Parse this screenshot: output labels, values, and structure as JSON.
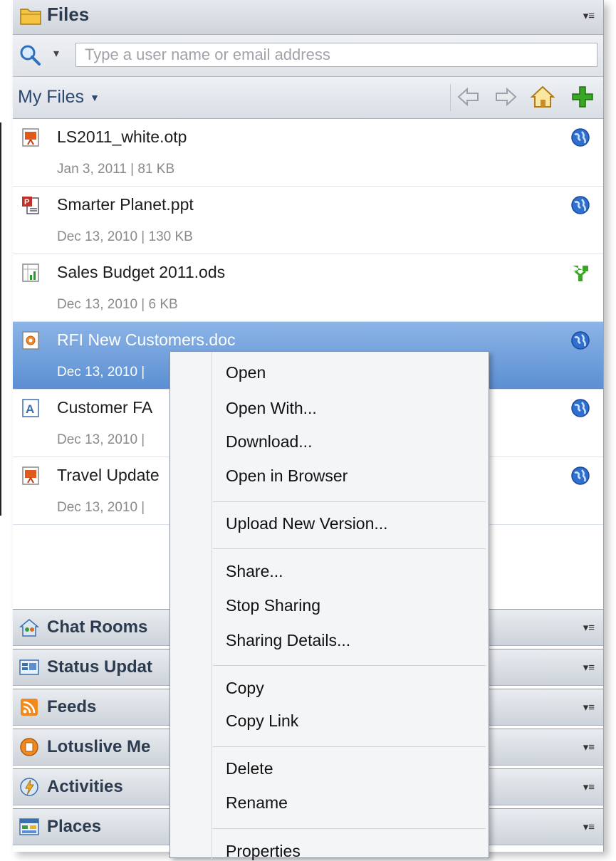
{
  "panel": {
    "title": "Files",
    "menu_glyph": "▾≡"
  },
  "search": {
    "placeholder": "Type a user name or email address",
    "value": ""
  },
  "nav": {
    "location_label": "My Files",
    "buttons": [
      "back-icon",
      "forward-icon",
      "home-icon",
      "add-icon"
    ]
  },
  "files": [
    {
      "name": "LS2011_white.otp",
      "meta": "Jan 3, 2011  |  81 KB",
      "icon": "presentation-icon",
      "status": "public-globe-icon"
    },
    {
      "name": "Smarter Planet.ppt",
      "meta": "Dec 13, 2010  |  130 KB",
      "icon": "powerpoint-icon",
      "status": "public-globe-icon"
    },
    {
      "name": "Sales Budget 2011.ods",
      "meta": "Dec 13, 2010  |  6 KB",
      "icon": "spreadsheet-icon",
      "status": "shared-icon"
    },
    {
      "name": "RFI New Customers.doc",
      "meta": "Dec 13, 2010  |",
      "icon": "document-icon",
      "status": "public-globe-icon",
      "selected": true
    },
    {
      "name": "Customer FA",
      "meta": "Dec 13, 2010  |",
      "icon": "text-document-icon",
      "status": "public-globe-icon"
    },
    {
      "name": "Travel Update",
      "meta": "Dec 13, 2010  |",
      "icon": "presentation-icon",
      "status": "public-globe-icon"
    }
  ],
  "sections": [
    {
      "label": "Chat Rooms",
      "icon": "chat-rooms-icon"
    },
    {
      "label": "Status Updat",
      "icon": "status-updates-icon"
    },
    {
      "label": "Feeds",
      "icon": "rss-feed-icon"
    },
    {
      "label": "Lotuslive Me",
      "icon": "lotuslive-icon"
    },
    {
      "label": "Activities",
      "icon": "activities-icon"
    },
    {
      "label": "Places",
      "icon": "places-icon"
    }
  ],
  "context_menu": {
    "items": [
      "Open",
      "Open With...",
      "Download...",
      "Open in Browser",
      "Upload New Version...",
      "Share...",
      "Stop Sharing",
      "Sharing Details...",
      "Copy",
      "Copy Link",
      "Delete",
      "Rename",
      "Properties"
    ]
  },
  "colors": {
    "selected_row": "#5b8fd3",
    "header_text": "#2c3b4f",
    "add_green": "#3aa626",
    "globe_blue": "#2f6fd0"
  }
}
